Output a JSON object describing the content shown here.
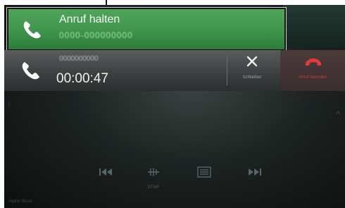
{
  "held_call": {
    "status": "Anruf halten",
    "number": "0000-000000000"
  },
  "active_call": {
    "number": "0000000000",
    "duration": "00:00:47",
    "close_label": "Schließen",
    "hangup_label": "Anruf beenden"
  },
  "controls": {
    "prev_icon": "skip-back-icon",
    "dtmf_icon": "keypad-icon",
    "dtmf_label": "DTMF",
    "list_icon": "list-icon",
    "next_icon": "skip-forward-icon"
  },
  "footer": {
    "text": "Alpine Music"
  },
  "colors": {
    "held_green": "#4ea65a",
    "active_gray": "#4a4d4d",
    "hangup_red": "#d13a3a"
  }
}
